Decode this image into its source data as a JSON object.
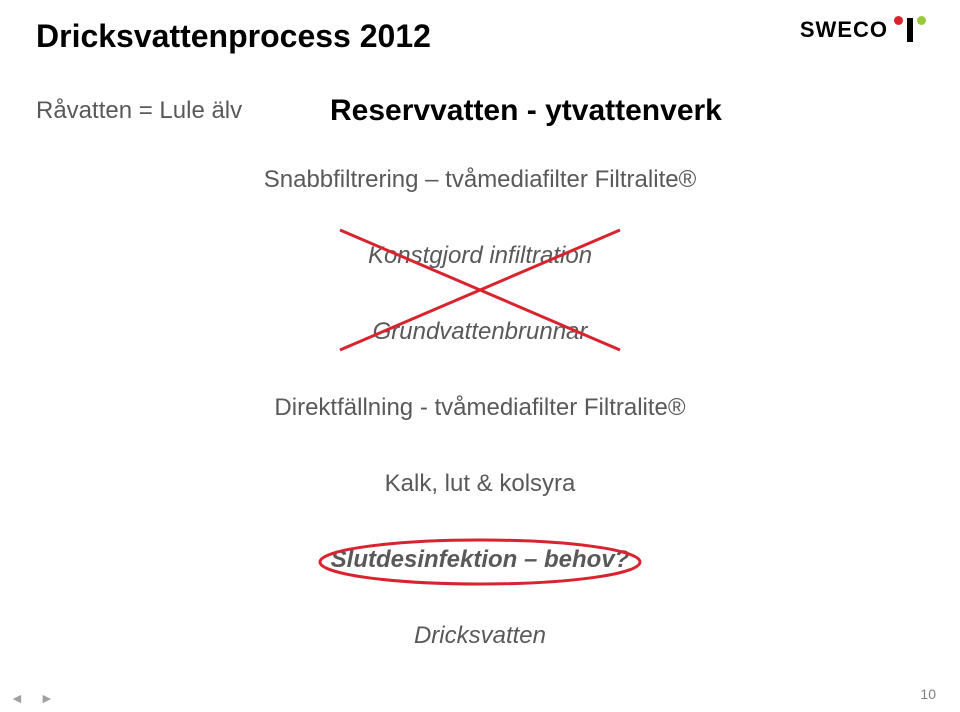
{
  "title": "Dricksvattenprocess 2012",
  "logo_text": "SWECO",
  "subtitle": "Råvatten = Lule älv",
  "reserv": "Reservvatten - ytvattenverk",
  "lines": {
    "snabb": "Snabbfiltrering – tvåmediafilter Filtralite®",
    "konst": "Konstgjord infiltration",
    "grund": "Grundvattenbrunnar",
    "direkt": "Direktfällning - tvåmediafilter Filtralite®",
    "kalk": "Kalk, lut & kolsyra",
    "slut": "Slutdesinfektion – behov?",
    "dricks": "Dricksvatten"
  },
  "page_number": "10",
  "nav": {
    "prev": "◄",
    "next": "►"
  }
}
